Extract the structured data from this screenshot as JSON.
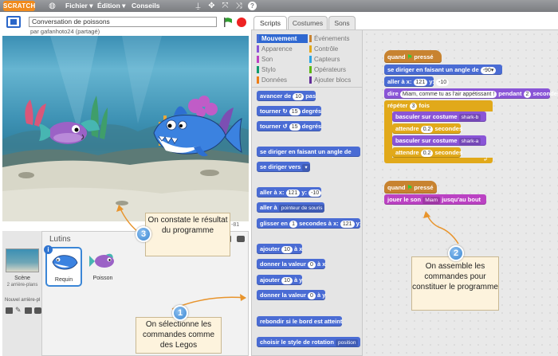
{
  "menubar": {
    "logo": "SCRATCH",
    "items": [
      "Fichier ▾",
      "Édition ▾",
      "Conseils"
    ]
  },
  "stage": {
    "project_title": "Conversation de poissons",
    "owner": "par gafanhoto24 (partagé)",
    "coord_readout": "-81"
  },
  "sprites": {
    "header": "Lutins",
    "scene_label": "Scène",
    "scene_sub": "2 arrière-plans",
    "new_backdrop": "Nouvel arrière-pl",
    "items": [
      {
        "name": "Requin",
        "selected": true
      },
      {
        "name": "Poisson",
        "selected": false
      }
    ]
  },
  "tabs": [
    "Scripts",
    "Costumes",
    "Sons"
  ],
  "categories": [
    {
      "label": "Mouvement",
      "color": "#4a6cd4",
      "selected": true
    },
    {
      "label": "Événements",
      "color": "#c88330",
      "selected": false
    },
    {
      "label": "Apparence",
      "color": "#8a55d7",
      "selected": false
    },
    {
      "label": "Contrôle",
      "color": "#e1a91a",
      "selected": false
    },
    {
      "label": "Son",
      "color": "#bb42c3",
      "selected": false
    },
    {
      "label": "Capteurs",
      "color": "#2ca5e2",
      "selected": false
    },
    {
      "label": "Stylo",
      "color": "#0e9a6c",
      "selected": false
    },
    {
      "label": "Opérateurs",
      "color": "#5cb712",
      "selected": false
    },
    {
      "label": "Données",
      "color": "#ee7d16",
      "selected": false
    },
    {
      "label": "Ajouter blocs",
      "color": "#632d99",
      "selected": false
    }
  ],
  "palette": {
    "move_prefix": "avancer de",
    "move_value": "10",
    "move_suffix": "pas",
    "turn_right_prefix": "tourner",
    "turn_value": "15",
    "turn_suffix": "degrés",
    "turn_left_prefix": "tourner",
    "turn_left_value": "15",
    "turn_left_suffix": "degrés",
    "point_dir": "se diriger en faisant un angle de",
    "point_towards": "se diriger vers",
    "goto_xy_prefix": "aller à x:",
    "goto_x": "121",
    "goto_y_label": "y:",
    "goto_y": "-10",
    "goto_prefix": "aller à",
    "goto_target": "pointeur de souris",
    "glide_prefix": "glisser en",
    "glide_secs": "1",
    "glide_mid": "secondes à x:",
    "glide_x": "121",
    "glide_y_label": "y:",
    "change_x_prefix": "ajouter",
    "change_x_value": "10",
    "change_x_suffix": "à x",
    "set_x_prefix": "donner la valeur",
    "set_x_value": "0",
    "set_x_suffix": "à x",
    "change_y_prefix": "ajouter",
    "change_y_value": "10",
    "change_y_suffix": "à y",
    "set_y_prefix": "donner la valeur",
    "set_y_value": "0",
    "set_y_suffix": "à y",
    "bounce": "rebondir si le bord est atteint",
    "rotation_style": "choisir le style de rotation",
    "rotation_value": "position"
  },
  "scripts": {
    "s1_hat": "quand",
    "s1_hat_suffix": "pressé",
    "s1_point": "se diriger en faisant un angle de",
    "s1_point_value": "-90▾",
    "s1_goto_prefix": "aller à x:",
    "s1_goto_x": "121",
    "s1_goto_ylabel": "y:",
    "s1_goto_y": "-10",
    "s1_say_prefix": "dire",
    "s1_say_text": "Miam, comme tu as l'air appétissant !",
    "s1_say_mid": "pendant",
    "s1_say_secs": "2",
    "s1_say_suffix": "secondes",
    "s1_repeat_prefix": "répéter",
    "s1_repeat_value": "3",
    "s1_repeat_suffix": "fois",
    "s1_costume1_prefix": "basculer sur costume",
    "s1_costume1_value": "shark-b",
    "s1_wait1_prefix": "attendre",
    "s1_wait1_value": "0.2",
    "s1_wait1_suffix": "secondes",
    "s1_costume2_prefix": "basculer sur costume",
    "s1_costume2_value": "shark-a",
    "s1_wait2_prefix": "attendre",
    "s1_wait2_value": "0.2",
    "s1_wait2_suffix": "secondes",
    "s2_hat": "quand",
    "s2_hat_suffix": "pressé",
    "s2_sound_prefix": "jouer le son",
    "s2_sound_value": "Miam",
    "s2_sound_suffix": "jusqu'au bout"
  },
  "callouts": {
    "c1_number": "1",
    "c1_text": "On sélectionne les commandes comme des Legos",
    "c2_number": "2",
    "c2_text": "On assemble les commandes pour constituer le programme",
    "c3_number": "3",
    "c3_text": "On constate le résultat du programme"
  }
}
